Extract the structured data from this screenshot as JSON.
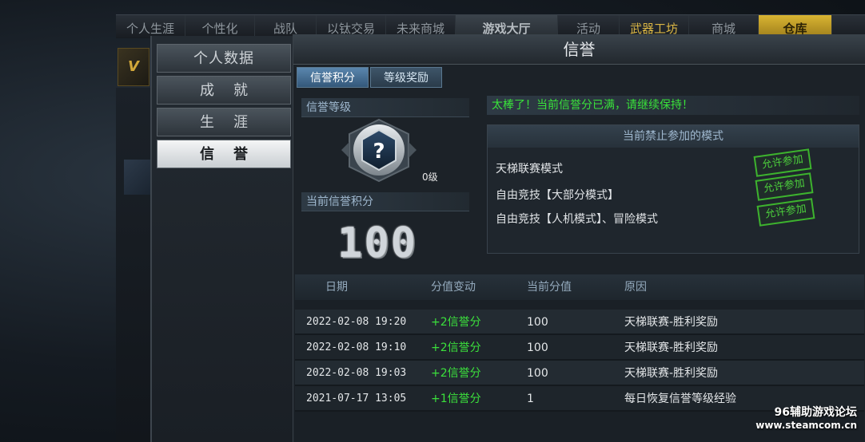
{
  "top_nav": {
    "items": [
      "个人生涯",
      "个性化",
      "战队",
      "以钛交易",
      "未来商城",
      "游戏大厅",
      "活动",
      "武器工坊",
      "商城",
      "仓库"
    ]
  },
  "vip": {
    "label": "V"
  },
  "side_menu": {
    "items": [
      "个人数据",
      "成就",
      "生涯",
      "信誉"
    ],
    "active": "信誉"
  },
  "panel": {
    "title": "信誉",
    "tabs": [
      "信誉积分",
      "等级奖励"
    ],
    "active_tab": "信誉积分"
  },
  "credit": {
    "level_label": "信誉等级",
    "level_value": "0级",
    "emblem_symbol": "?",
    "score_label": "当前信誉积分",
    "score": "100"
  },
  "status": {
    "message": "太棒了！当前信誉分已满，请继续保持！"
  },
  "ban_box": {
    "header": "当前禁止参加的模式",
    "rows": [
      {
        "mode": "天梯联赛模式",
        "action": "允许参加"
      },
      {
        "mode": "自由竞技【大部分模式】",
        "action": "允许参加"
      },
      {
        "mode": "自由竞技【人机模式】、冒险模式",
        "action": "允许参加"
      }
    ]
  },
  "records": {
    "headers": [
      "日期",
      "分值变动",
      "当前分值",
      "原因"
    ],
    "rows": [
      {
        "date": "2022-02-08 19:20",
        "change": "+2信誉分",
        "current": "100",
        "reason": "天梯联赛-胜利奖励"
      },
      {
        "date": "2022-02-08 19:10",
        "change": "+2信誉分",
        "current": "100",
        "reason": "天梯联赛-胜利奖励"
      },
      {
        "date": "2022-02-08 19:03",
        "change": "+2信誉分",
        "current": "100",
        "reason": "天梯联赛-胜利奖励"
      },
      {
        "date": "2021-07-17 13:05",
        "change": "+1信誉分",
        "current": "1",
        "reason": "每日恢复信誉等级经验"
      }
    ]
  },
  "watermark": {
    "line1": "96辅助游戏论坛",
    "line2": "www.steamcom.cn"
  },
  "colors": {
    "accent_green": "#39e23a",
    "tab_blue": "#5a86ad",
    "gold": "#d9b544"
  }
}
